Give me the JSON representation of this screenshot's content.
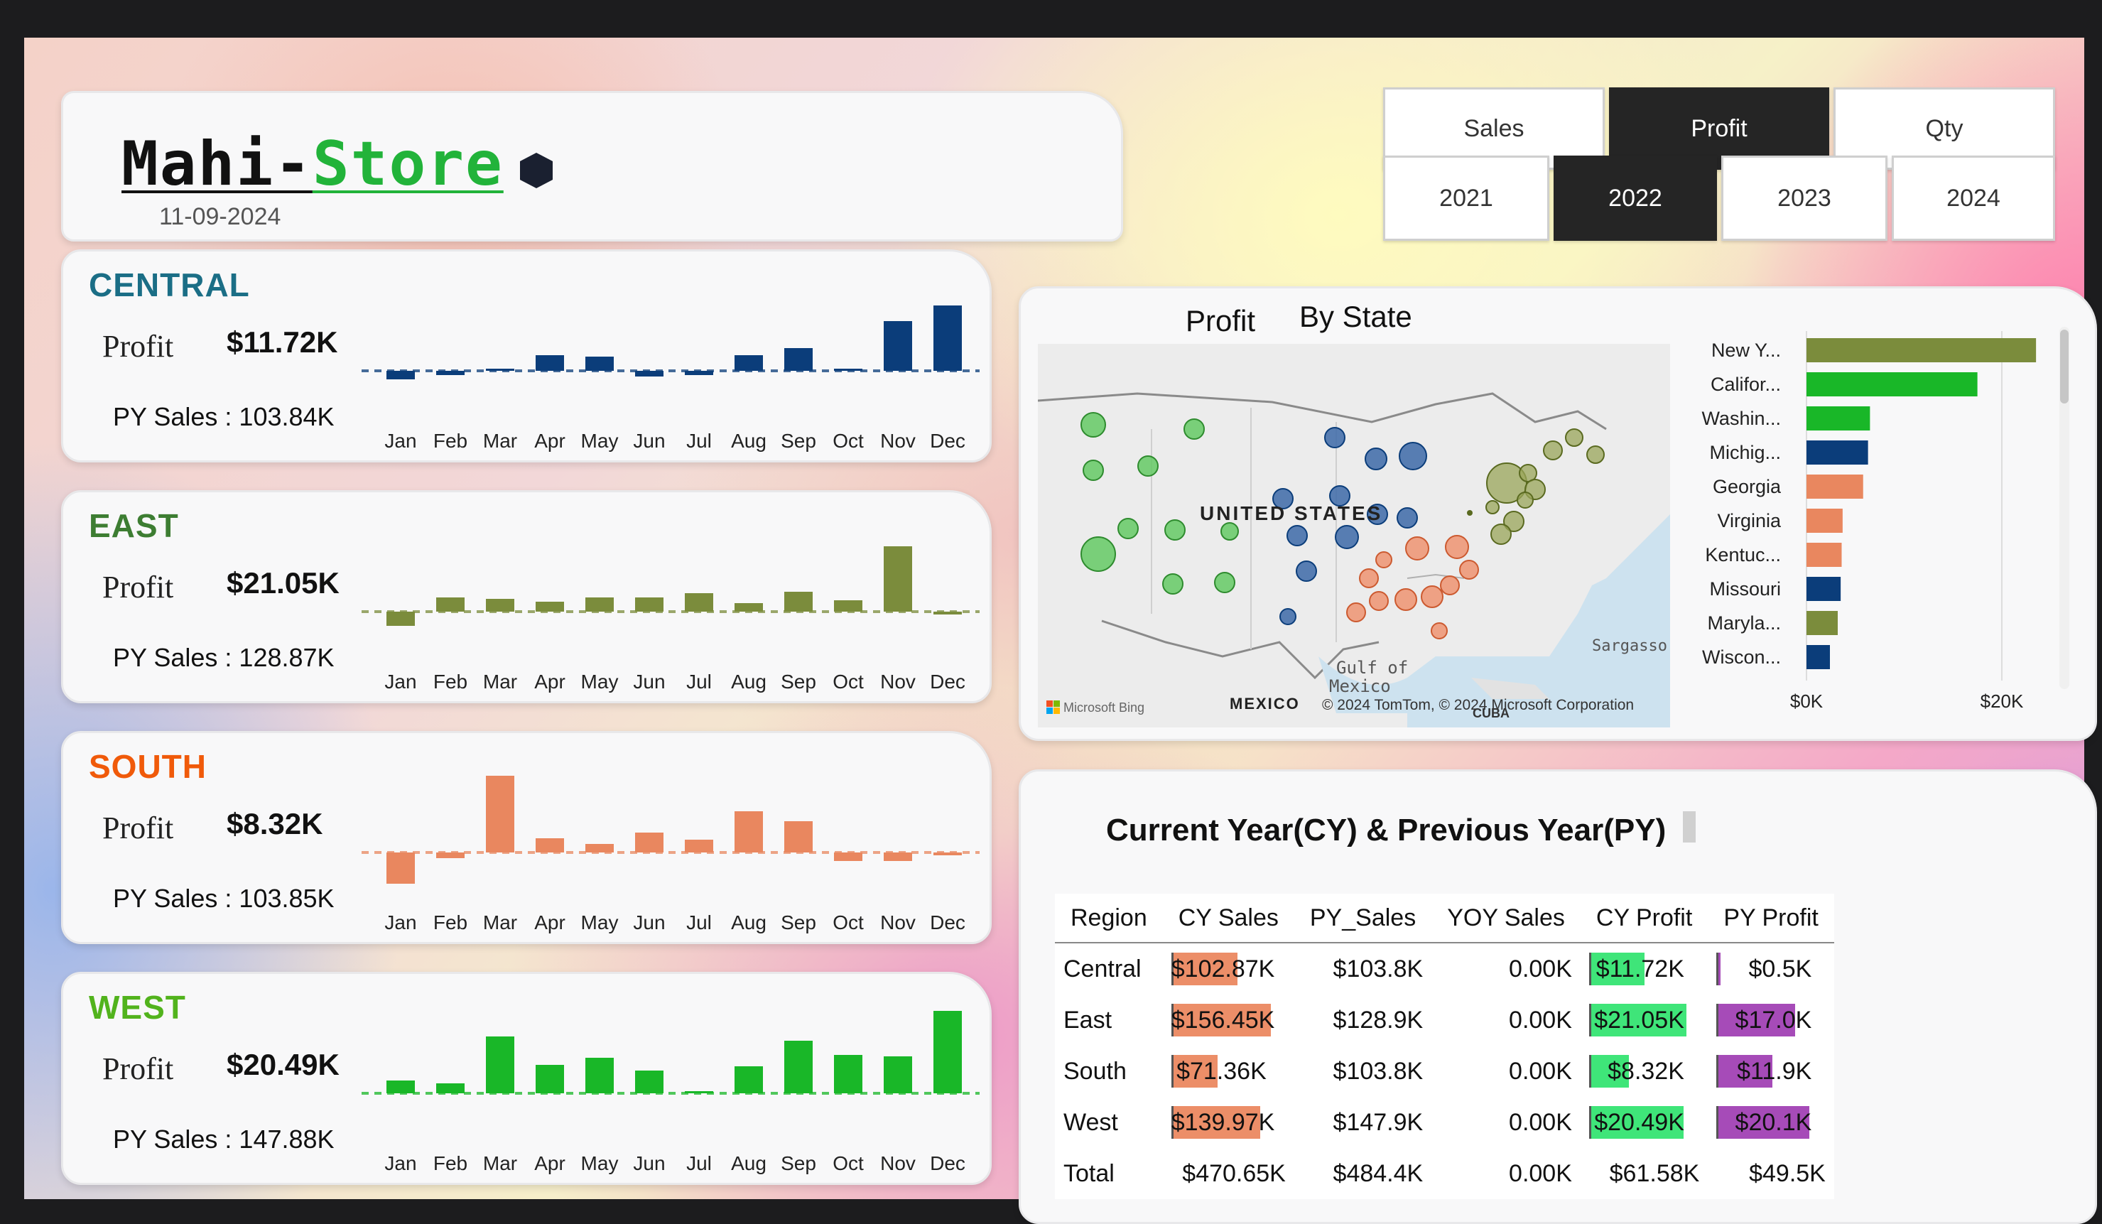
{
  "header": {
    "brand_part1": "Mahi-",
    "brand_part2": "Store",
    "date": "11-09-2024"
  },
  "measure_buttons": [
    "Sales",
    "Profit",
    "Qty"
  ],
  "measure_active": "Profit",
  "year_buttons": [
    "2021",
    "2022",
    "2023",
    "2024"
  ],
  "year_active": "2022",
  "months": [
    "Jan",
    "Feb",
    "Mar",
    "Apr",
    "May",
    "Jun",
    "Jul",
    "Aug",
    "Sep",
    "Oct",
    "Nov",
    "Dec"
  ],
  "regions": [
    {
      "name": "CENTRAL",
      "color": "#0b3d7a",
      "name_color": "#1b6e86",
      "label": "Profit",
      "value": "$11.72K",
      "py": "PY Sales : 103.84K",
      "monthly": [
        -0.6,
        -0.3,
        0.1,
        1.1,
        1.0,
        -0.4,
        -0.3,
        1.1,
        1.6,
        0.1,
        3.5,
        4.6
      ]
    },
    {
      "name": "EAST",
      "color": "#7b8c3c",
      "name_color": "#3d7d32",
      "label": "Profit",
      "value": "$21.05K",
      "py": "PY Sales : 128.87K",
      "monthly": [
        -1.0,
        1.0,
        0.9,
        0.7,
        1.0,
        1.0,
        1.3,
        0.6,
        1.4,
        0.8,
        4.6,
        -0.2
      ]
    },
    {
      "name": "SOUTH",
      "color": "#e9875f",
      "name_color": "#f05a0a",
      "label": "Profit",
      "value": "$8.32K",
      "py": "PY Sales : 103.85K",
      "monthly": [
        -2.2,
        -0.4,
        5.4,
        1.0,
        0.6,
        1.4,
        0.9,
        2.9,
        2.2,
        -0.6,
        -0.6,
        -0.2
      ]
    },
    {
      "name": "WEST",
      "color": "#19b728",
      "name_color": "#52b31d",
      "label": "Profit",
      "value": "$20.49K",
      "py": "PY Sales : 147.88K",
      "monthly": [
        0.9,
        0.7,
        4.0,
        2.0,
        2.5,
        1.6,
        0.1,
        1.9,
        3.7,
        2.7,
        2.6,
        5.8
      ]
    }
  ],
  "map_section": {
    "title_a": "Profit",
    "title_b": "By State",
    "labels": {
      "country": "UNITED STATES",
      "mexico": "MEXICO",
      "gulf1": "Gulf of",
      "gulf2": "Mexico",
      "sargasso": "Sargasso",
      "cuba": "CUBA",
      "credit": "© 2024 TomTom, © 2024 Microsoft Corporation",
      "bing": "Microsoft Bing"
    }
  },
  "state_chart": {
    "states": [
      "New Y...",
      "Califor...",
      "Washin...",
      "Michig...",
      "Georgia",
      "Virginia",
      "Kentuc...",
      "Missouri",
      "Maryla...",
      "Wiscon..."
    ],
    "values": [
      23.5,
      17.5,
      6.5,
      6.3,
      5.8,
      3.7,
      3.6,
      3.5,
      3.2,
      2.4
    ],
    "colors": [
      "#7b8c3c",
      "#19b728",
      "#19b728",
      "#0b3d7a",
      "#e9875f",
      "#e9875f",
      "#e9875f",
      "#0b3d7a",
      "#7b8c3c",
      "#0b3d7a"
    ],
    "axis_min_label": "$0K",
    "axis_max_label": "$20K",
    "axis_max": 24
  },
  "table_section": {
    "title": "Current Year(CY) & Previous Year(PY)",
    "columns": [
      "Region",
      "CY Sales",
      "PY_Sales",
      "YOY Sales",
      "CY Profit",
      "PY Profit"
    ],
    "rows": [
      {
        "region": "Central",
        "cy_sales": "$102.87K",
        "py_sales": "$103.8K",
        "yoy": "0.00K",
        "cy_profit": "$11.72K",
        "py_profit": "$0.5K"
      },
      {
        "region": "East",
        "cy_sales": "$156.45K",
        "py_sales": "$128.9K",
        "yoy": "0.00K",
        "cy_profit": "$21.05K",
        "py_profit": "$17.0K"
      },
      {
        "region": "South",
        "cy_sales": "$71.36K",
        "py_sales": "$103.8K",
        "yoy": "0.00K",
        "cy_profit": "$8.32K",
        "py_profit": "$11.9K"
      },
      {
        "region": "West",
        "cy_sales": "$139.97K",
        "py_sales": "$147.9K",
        "yoy": "0.00K",
        "cy_profit": "$20.49K",
        "py_profit": "$20.1K"
      }
    ],
    "total": {
      "region": "Total",
      "cy_sales": "$470.65K",
      "py_sales": "$484.4K",
      "yoy": "0.00K",
      "cy_profit": "$61.58K",
      "py_profit": "$49.5K"
    },
    "bar_values": {
      "cy_sales": [
        102.87,
        156.45,
        71.36,
        139.97
      ],
      "cy_profit": [
        11.72,
        21.05,
        8.32,
        20.49
      ],
      "py_profit": [
        0.5,
        17.0,
        11.9,
        20.1
      ]
    },
    "bar_colors": {
      "cy_sales": "#ec8e68",
      "cy_profit": "#3fe579",
      "py_profit": "#a64bb8"
    }
  }
}
